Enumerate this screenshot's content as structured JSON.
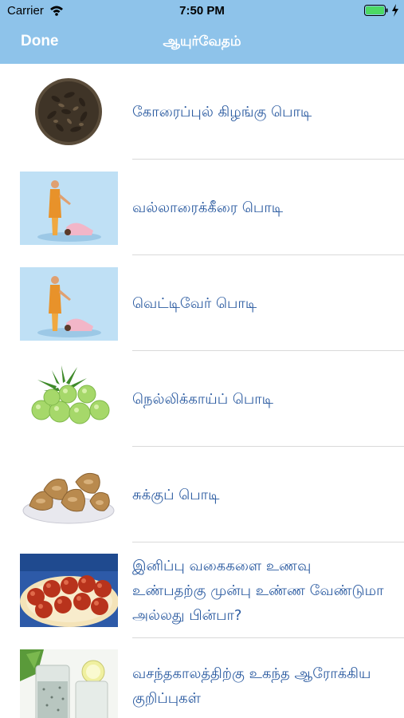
{
  "status_bar": {
    "carrier": "Carrier",
    "time": "7:50 PM"
  },
  "nav": {
    "done_label": "Done",
    "title": "ஆயுர்வேதம்"
  },
  "items": [
    {
      "label": "கோரைப்புல் கிழங்கு பொடி",
      "image": "dried-tubers-bowl"
    },
    {
      "label": "வல்லாரைக்கீரை  பொடி",
      "image": "sage-blessing-devotee"
    },
    {
      "label": "வெட்டிவேர் பொடி",
      "image": "sage-blessing-devotee"
    },
    {
      "label": "நெல்லிக்காய்ப் பொடி",
      "image": "amla-gooseberries"
    },
    {
      "label": "சுக்குப் பொடி",
      "image": "dry-ginger-plate"
    },
    {
      "label": "இனிப்பு வகைகளை உணவு உண்பதற்கு முன்பு உண்ண வேண்டுமா அல்லது பின்பா?",
      "image": "gulab-jamun-plate"
    },
    {
      "label": "வசந்தகாலத்திற்கு உகந்த ஆரோக்கிய குறிப்புகள்",
      "image": "herbal-drink-glasses"
    }
  ]
}
